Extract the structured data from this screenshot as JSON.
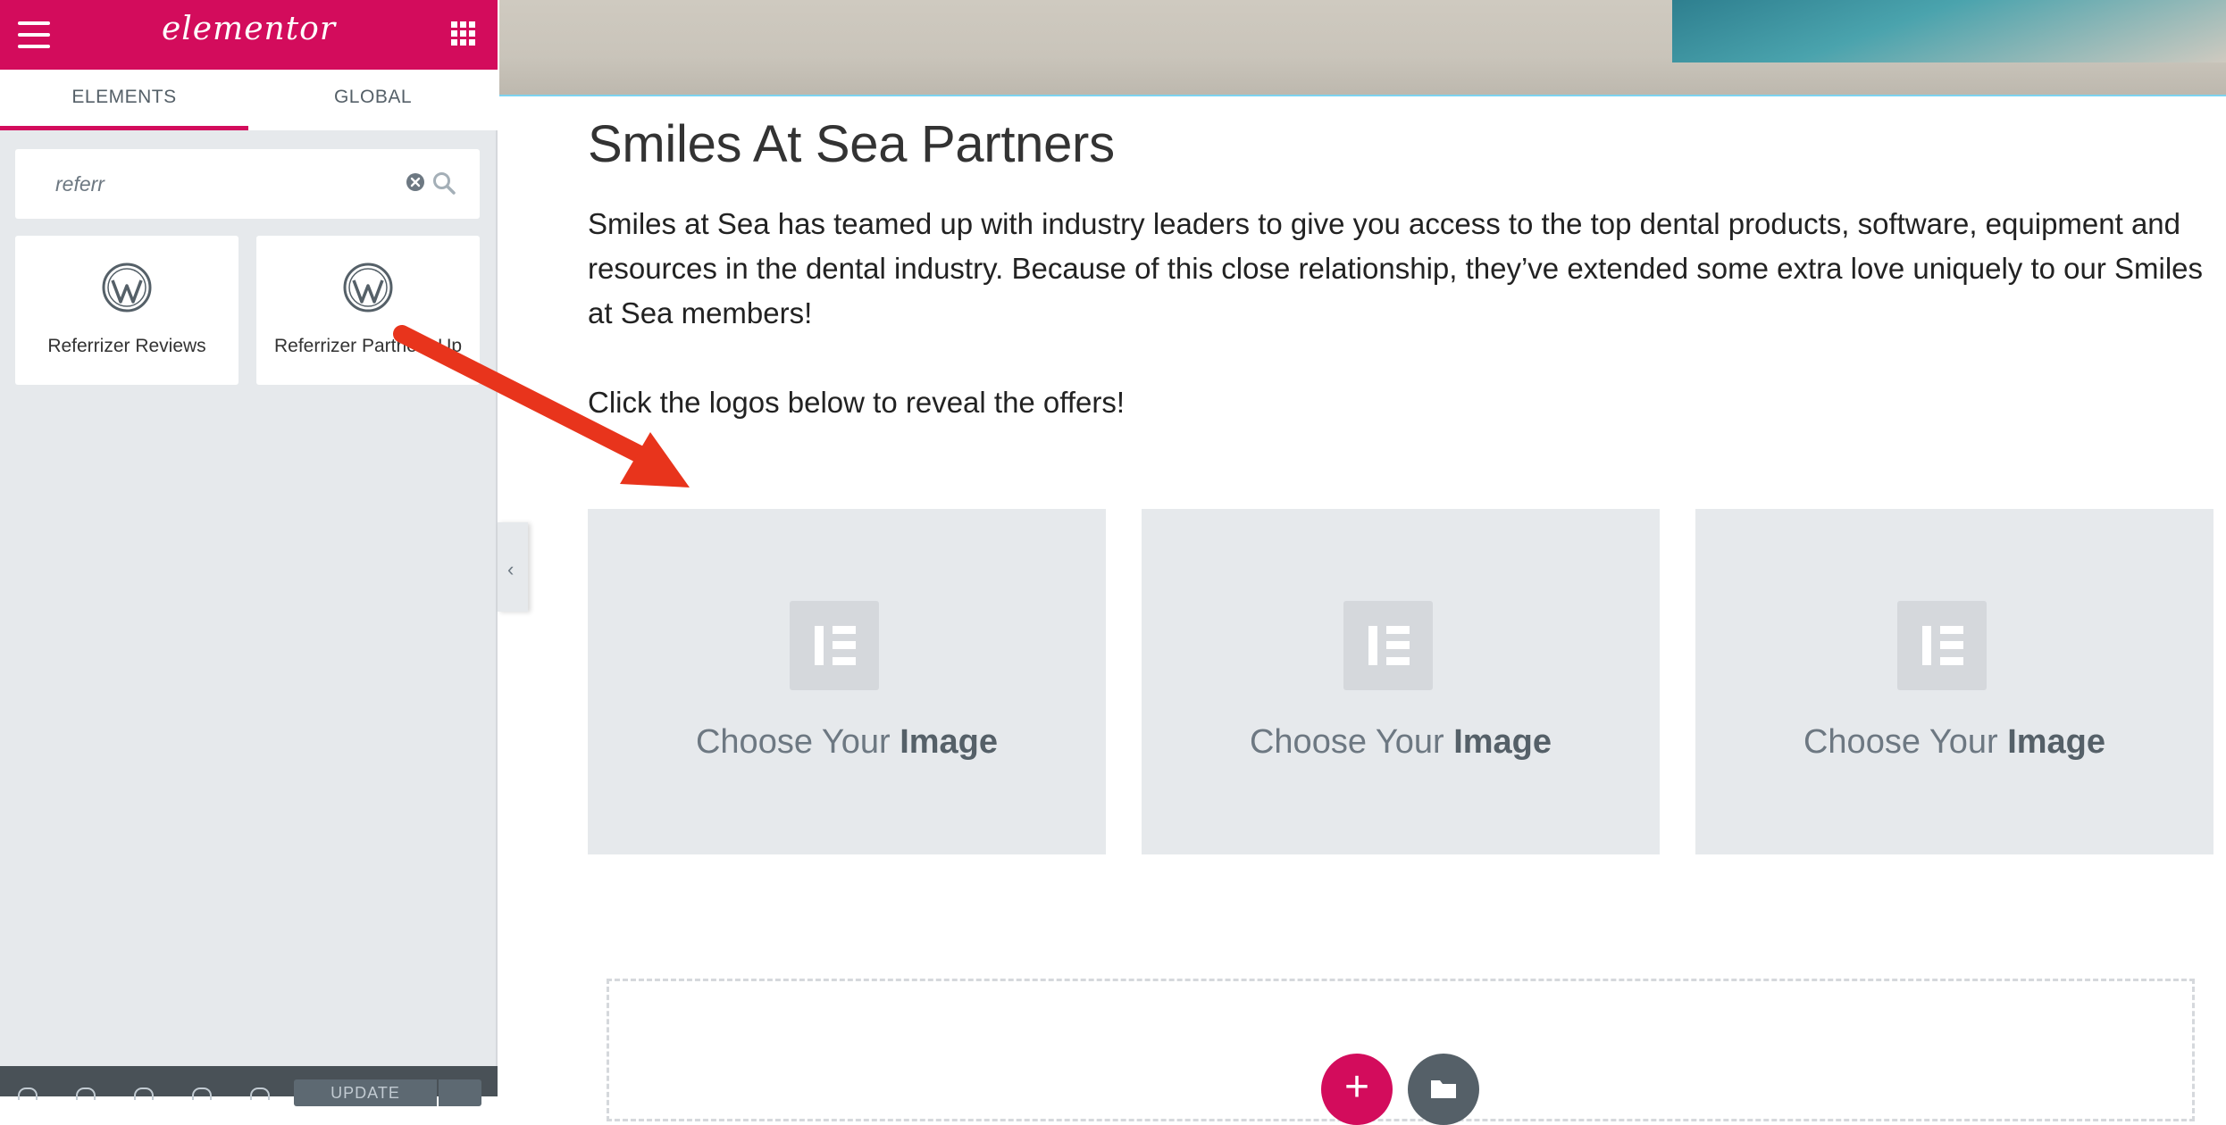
{
  "panel": {
    "brand": "elementor",
    "tabs": [
      "ELEMENTS",
      "GLOBAL"
    ],
    "search": {
      "value": "referr"
    },
    "widgets": [
      "Referrizer Reviews",
      "Referrizer Partners Up"
    ],
    "footer": {
      "update_label": "UPDATE"
    }
  },
  "canvas": {
    "heading": "Smiles At Sea Partners",
    "paragraph_1": "Smiles at Sea has teamed up with industry leaders to give you access to the top dental products, software, equipment and resources in the dental industry. Because of this close relationship, they’ve extended some extra love uniquely to our Smiles at Sea members!",
    "paragraph_2": "Click the logos below to reveal the offers!",
    "placeholders": [
      {
        "prefix": "Choose Your",
        "bold": "Image"
      },
      {
        "prefix": "Choose Your",
        "bold": "Image"
      },
      {
        "prefix": "Choose Your",
        "bold": "Image"
      }
    ]
  },
  "colors": {
    "brand": "#d30c5c",
    "panel_bg": "#e6e9ec",
    "annotation_arrow": "#e8341c"
  },
  "icons": [
    "menu-icon",
    "apps-grid-icon",
    "clear-icon",
    "search-icon",
    "wordpress-icon",
    "elementor-icon",
    "collapse-chevron-icon",
    "plus-icon",
    "folder-icon"
  ]
}
